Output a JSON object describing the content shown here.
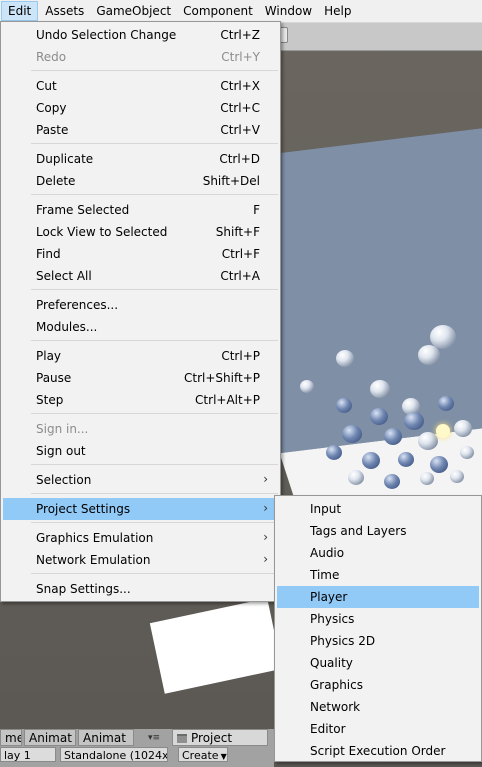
{
  "menubar": {
    "items": [
      {
        "label": "Edit",
        "active": true
      },
      {
        "label": "Assets"
      },
      {
        "label": "GameObject"
      },
      {
        "label": "Component"
      },
      {
        "label": "Window"
      },
      {
        "label": "Help"
      }
    ]
  },
  "edit_menu": {
    "items": [
      {
        "label": "Undo Selection Change",
        "shortcut": "Ctrl+Z"
      },
      {
        "label": "Redo",
        "shortcut": "Ctrl+Y",
        "disabled": true
      },
      {
        "label": "Cut",
        "shortcut": "Ctrl+X"
      },
      {
        "label": "Copy",
        "shortcut": "Ctrl+C"
      },
      {
        "label": "Paste",
        "shortcut": "Ctrl+V"
      },
      {
        "label": "Duplicate",
        "shortcut": "Ctrl+D"
      },
      {
        "label": "Delete",
        "shortcut": "Shift+Del"
      },
      {
        "label": "Frame Selected",
        "shortcut": "F"
      },
      {
        "label": "Lock View to Selected",
        "shortcut": "Shift+F"
      },
      {
        "label": "Find",
        "shortcut": "Ctrl+F"
      },
      {
        "label": "Select All",
        "shortcut": "Ctrl+A"
      },
      {
        "label": "Preferences...",
        "shortcut": ""
      },
      {
        "label": "Modules...",
        "shortcut": ""
      },
      {
        "label": "Play",
        "shortcut": "Ctrl+P"
      },
      {
        "label": "Pause",
        "shortcut": "Ctrl+Shift+P"
      },
      {
        "label": "Step",
        "shortcut": "Ctrl+Alt+P"
      },
      {
        "label": "Sign in...",
        "shortcut": "",
        "disabled": true
      },
      {
        "label": "Sign out",
        "shortcut": ""
      },
      {
        "label": "Selection",
        "shortcut": "",
        "submenu": true
      },
      {
        "label": "Project Settings",
        "shortcut": "",
        "submenu": true,
        "highlighted": true
      },
      {
        "label": "Graphics Emulation",
        "shortcut": "",
        "submenu": true
      },
      {
        "label": "Network Emulation",
        "shortcut": "",
        "submenu": true
      },
      {
        "label": "Snap Settings...",
        "shortcut": ""
      }
    ]
  },
  "project_settings_submenu": {
    "items": [
      {
        "label": "Input"
      },
      {
        "label": "Tags and Layers"
      },
      {
        "label": "Audio"
      },
      {
        "label": "Time"
      },
      {
        "label": "Player",
        "highlighted": true
      },
      {
        "label": "Physics"
      },
      {
        "label": "Physics 2D"
      },
      {
        "label": "Quality"
      },
      {
        "label": "Graphics"
      },
      {
        "label": "Network"
      },
      {
        "label": "Editor"
      },
      {
        "label": "Script Execution Order"
      }
    ]
  },
  "bottom_panel": {
    "tabs": [
      {
        "label": "me"
      },
      {
        "label": "Animat"
      },
      {
        "label": "Animat"
      },
      {
        "label": "Project"
      }
    ],
    "display_field": "lay 1",
    "resolution_field": "Standalone (1024x7",
    "create_button": "Create"
  },
  "colors": {
    "menu_highlight": "#91c9f7",
    "menubar_active": "#cce4f7",
    "menu_background": "#f2f2f2",
    "disabled_text": "#8c8c8c"
  },
  "icons": {
    "submenu_arrow": "chevron-right-icon",
    "scene_light": "sun-icon",
    "project_tab": "folder-icon"
  }
}
